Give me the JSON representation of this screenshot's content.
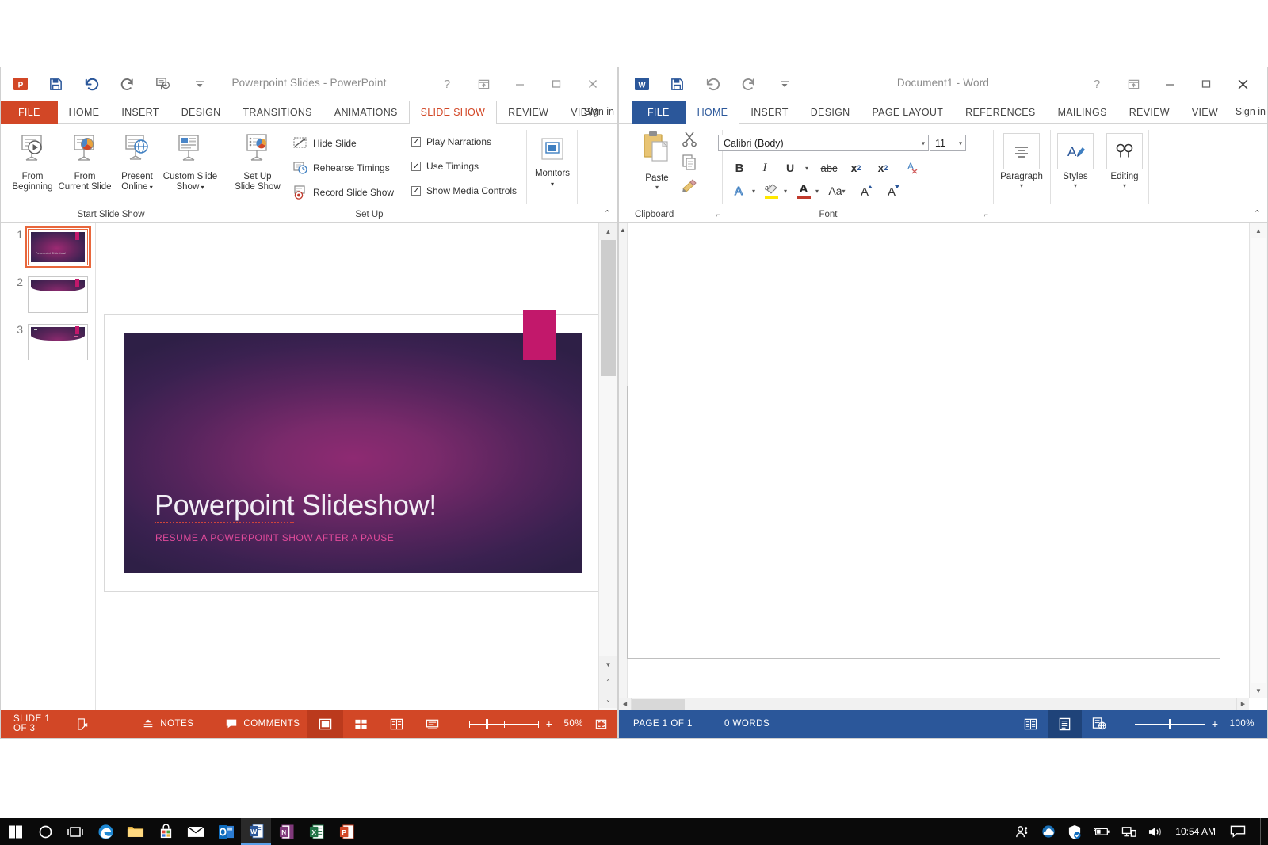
{
  "powerpoint": {
    "title": "Powerpoint Slides - PowerPoint",
    "app_icon": "powerpoint-icon",
    "accent": "#d24726",
    "quick_access": [
      {
        "name": "save-icon",
        "label": "Save"
      },
      {
        "name": "undo-icon",
        "label": "Undo"
      },
      {
        "name": "redo-icon",
        "label": "Redo"
      },
      {
        "name": "start-from-beginning-icon",
        "label": "Start From Beginning"
      },
      {
        "name": "customize-quick-access-caret",
        "label": "Customize Quick Access Toolbar"
      }
    ],
    "caption": {
      "help": "?",
      "ribbon_display": "ribbon-display-options",
      "minimize": "–",
      "restore": "□",
      "close": "✕"
    },
    "sign_in": "Sign in",
    "tabs": [
      {
        "label": "FILE",
        "active": false,
        "file": true
      },
      {
        "label": "HOME",
        "active": false
      },
      {
        "label": "INSERT",
        "active": false
      },
      {
        "label": "DESIGN",
        "active": false
      },
      {
        "label": "TRANSITIONS",
        "active": false
      },
      {
        "label": "ANIMATIONS",
        "active": false
      },
      {
        "label": "SLIDE SHOW",
        "active": true
      },
      {
        "label": "REVIEW",
        "active": false
      },
      {
        "label": "VIEW",
        "active": false
      }
    ],
    "groups": [
      {
        "name": "start-slide-show",
        "label": "Start Slide Show"
      },
      {
        "name": "set-up",
        "label": "Set Up"
      },
      {
        "name": "monitors",
        "label": ""
      }
    ],
    "start_slide_show_buttons": [
      {
        "name": "from-beginning-button",
        "line1": "From",
        "line2": "Beginning"
      },
      {
        "name": "from-current-slide-button",
        "line1": "From",
        "line2": "Current Slide"
      },
      {
        "name": "present-online-button",
        "line1": "Present",
        "line2": "Online"
      },
      {
        "name": "custom-slide-show-button",
        "line1": "Custom Slide",
        "line2": "Show"
      }
    ],
    "setup_big_button": {
      "name": "set-up-slide-show-button",
      "line1": "Set Up",
      "line2": "Slide Show"
    },
    "setup_small_buttons": [
      {
        "name": "hide-slide-button",
        "label": "Hide Slide"
      },
      {
        "name": "rehearse-timings-button",
        "label": "Rehearse Timings"
      },
      {
        "name": "record-slide-show-button",
        "label": "Record Slide Show"
      }
    ],
    "setup_checkboxes": [
      {
        "name": "play-narrations-checkbox",
        "label": "Play Narrations",
        "checked": true
      },
      {
        "name": "use-timings-checkbox",
        "label": "Use Timings",
        "checked": true
      },
      {
        "name": "show-media-controls-checkbox",
        "label": "Show Media Controls",
        "checked": true
      }
    ],
    "monitors_button": {
      "name": "monitors-button",
      "label": "Monitors"
    },
    "collapse_ribbon": "collapse-ribbon-icon",
    "thumbnails": [
      {
        "number": "1",
        "selected": true
      },
      {
        "number": "2",
        "selected": false
      },
      {
        "number": "3",
        "selected": false
      }
    ],
    "slide": {
      "title": "Powerpoint Slideshow!",
      "title_underlined_part": "Powerpoint",
      "title_rest": " Slideshow!",
      "subtitle": "RESUME A POWERPOINT SHOW AFTER A PAUSE",
      "tag_color": "#c2186b"
    },
    "status": {
      "slide_counter": "SLIDE 1 OF 3",
      "language_icon": "language-proofing-icon",
      "notes": "NOTES",
      "comments": "COMMENTS",
      "views": [
        {
          "name": "normal-view-button",
          "active": true
        },
        {
          "name": "slide-sorter-view-button",
          "active": false
        },
        {
          "name": "reading-view-button",
          "active": false
        },
        {
          "name": "slide-show-view-button",
          "active": false
        }
      ],
      "zoom_out": "–",
      "zoom_in": "+",
      "zoom_level": "50%",
      "fit_slide_icon": "fit-slide-to-window-icon"
    }
  },
  "word": {
    "title": "Document1 - Word",
    "app_icon": "word-icon",
    "accent": "#2b579a",
    "quick_access": [
      {
        "name": "save-icon",
        "label": "Save"
      },
      {
        "name": "undo-icon",
        "label": "Undo"
      },
      {
        "name": "redo-icon",
        "label": "Redo"
      },
      {
        "name": "customize-quick-access-caret",
        "label": "Customize Quick Access Toolbar"
      }
    ],
    "caption": {
      "help": "?",
      "ribbon_display": "ribbon-display-options",
      "minimize": "–",
      "restore": "□",
      "close": "✕"
    },
    "sign_in": "Sign in",
    "tabs": [
      {
        "label": "FILE",
        "active": false,
        "file": true
      },
      {
        "label": "HOME",
        "active": true
      },
      {
        "label": "INSERT",
        "active": false
      },
      {
        "label": "DESIGN",
        "active": false
      },
      {
        "label": "PAGE LAYOUT",
        "active": false
      },
      {
        "label": "REFERENCES",
        "active": false
      },
      {
        "label": "MAILINGS",
        "active": false
      },
      {
        "label": "REVIEW",
        "active": false
      },
      {
        "label": "VIEW",
        "active": false
      }
    ],
    "groups": [
      {
        "name": "clipboard-group",
        "label": "Clipboard"
      },
      {
        "name": "font-group",
        "label": "Font"
      }
    ],
    "clipboard": {
      "paste_label": "Paste",
      "cut": "cut-icon",
      "copy": "copy-icon",
      "format_painter": "format-painter-icon"
    },
    "font": {
      "family_value": "Calibri (Body)",
      "size_value": "11",
      "row1": [
        {
          "name": "bold-button",
          "glyph": "B"
        },
        {
          "name": "italic-button",
          "glyph": "I"
        },
        {
          "name": "underline-button",
          "glyph": "U"
        },
        {
          "name": "strikethrough-button",
          "glyph": "abc"
        },
        {
          "name": "subscript-button",
          "glyph": "x₂"
        },
        {
          "name": "superscript-button",
          "glyph": "x²"
        },
        {
          "name": "clear-formatting-button",
          "glyph": "A"
        }
      ],
      "row2": [
        {
          "name": "text-effects-button",
          "glyph": "A"
        },
        {
          "name": "text-highlight-color-button",
          "glyph": "ab"
        },
        {
          "name": "font-color-button",
          "glyph": "A"
        },
        {
          "name": "change-case-button",
          "glyph": "Aa"
        },
        {
          "name": "grow-font-button",
          "glyph": "A"
        },
        {
          "name": "shrink-font-button",
          "glyph": "A"
        }
      ]
    },
    "right_groups": [
      {
        "name": "paragraph-group-button",
        "label": "Paragraph"
      },
      {
        "name": "styles-group-button",
        "label": "Styles"
      },
      {
        "name": "editing-group-button",
        "label": "Editing"
      }
    ],
    "status": {
      "page_counter": "PAGE 1 OF 1",
      "word_count": "0 WORDS",
      "views": [
        {
          "name": "read-mode-button",
          "active": false
        },
        {
          "name": "print-layout-button",
          "active": true
        },
        {
          "name": "web-layout-button",
          "active": false
        }
      ],
      "zoom_out": "–",
      "zoom_in": "+",
      "zoom_level": "100%"
    }
  },
  "taskbar": {
    "items": [
      {
        "name": "start-button",
        "label": "Start"
      },
      {
        "name": "cortana-search-icon",
        "label": "Cortana"
      },
      {
        "name": "task-view-icon",
        "label": "Task View"
      },
      {
        "name": "edge-icon",
        "label": "Microsoft Edge"
      },
      {
        "name": "file-explorer-icon",
        "label": "File Explorer"
      },
      {
        "name": "store-icon",
        "label": "Store"
      },
      {
        "name": "mail-icon",
        "label": "Mail"
      },
      {
        "name": "outlook-icon",
        "label": "Outlook"
      },
      {
        "name": "word-taskbar-icon",
        "label": "Word",
        "active": true
      },
      {
        "name": "onenote-taskbar-icon",
        "label": "OneNote"
      },
      {
        "name": "excel-taskbar-icon",
        "label": "Excel"
      },
      {
        "name": "powerpoint-taskbar-icon",
        "label": "PowerPoint"
      }
    ],
    "tray": [
      {
        "name": "people-icon",
        "label": "People"
      },
      {
        "name": "onedrive-icon",
        "label": "OneDrive"
      },
      {
        "name": "security-shield-icon",
        "label": "Windows Security"
      },
      {
        "name": "battery-icon",
        "label": "Battery"
      },
      {
        "name": "network-icon",
        "label": "Network"
      },
      {
        "name": "volume-icon",
        "label": "Volume"
      }
    ],
    "clock": "10:54 AM",
    "action_center": "action-center-icon"
  }
}
